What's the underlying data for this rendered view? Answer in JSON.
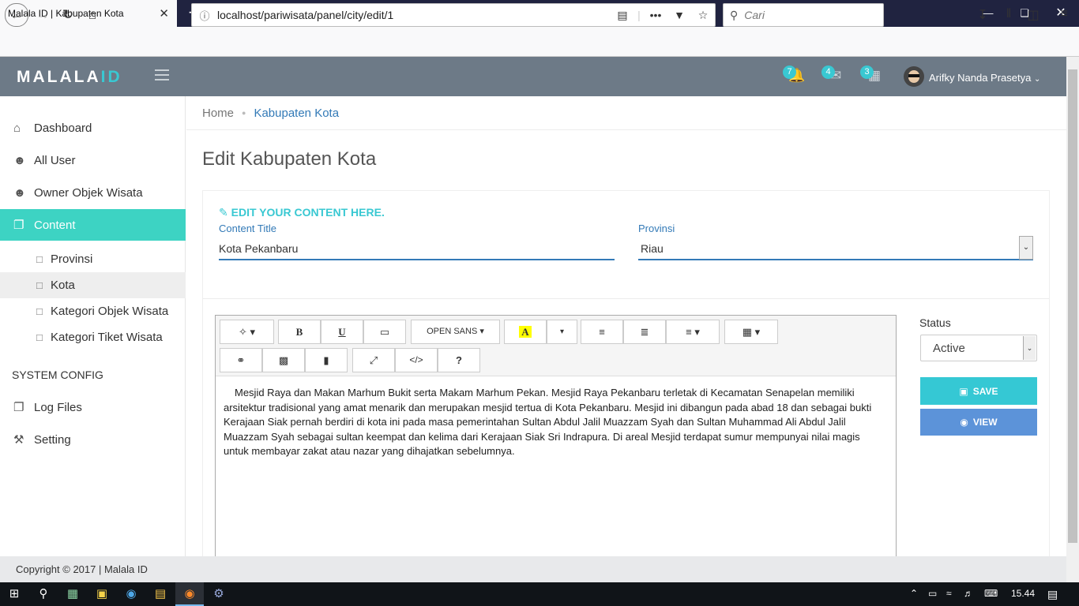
{
  "browser": {
    "tab_title": "Malala ID | Kabupaten Kota",
    "tab_close": "✕",
    "new_tab": "+",
    "url": "localhost/pariwisata/panel/city/edit/1",
    "search_placeholder": "Cari"
  },
  "header": {
    "logo_main": "MALALA",
    "logo_accent": "ID",
    "notifications_count": "7",
    "messages_count": "4",
    "calendar_count": "3",
    "user_name": "Arifky Nanda Prasetya"
  },
  "sidebar": {
    "items": [
      {
        "label": "Dashboard",
        "icon": "home-icon"
      },
      {
        "label": "All User",
        "icon": "user-icon"
      },
      {
        "label": "Owner Objek Wisata",
        "icon": "user-icon"
      },
      {
        "label": "Content",
        "icon": "copy-icon"
      }
    ],
    "sub_items": [
      "Provinsi",
      "Kota",
      "Kategori Objek Wisata",
      "Kategori Tiket Wisata"
    ],
    "section_label": "SYSTEM CONFIG",
    "config_items": [
      "Log Files",
      "Setting"
    ]
  },
  "breadcrumb": {
    "home": "Home",
    "current": "Kabupaten Kota"
  },
  "page_title": "Edit Kabupaten Kota",
  "form": {
    "header": "EDIT YOUR CONTENT HERE.",
    "title_label": "Content Title",
    "title_value": "Kota Pekanbaru",
    "province_label": "Provinsi",
    "province_value": "Riau",
    "font_label": "OPEN SANS",
    "content": "Mesjid Raya dan Makan Marhum Bukit serta Makam Marhum Pekan. Mesjid Raya Pekanbaru terletak di Kecamatan Senapelan memiliki arsitektur tradisional yang amat menarik dan merupakan mesjid tertua di Kota Pekanbaru. Mesjid ini dibangun pada abad 18 dan sebagai bukti Kerajaan Siak pernah berdiri di kota ini pada masa pemerintahan Sultan Abdul Jalil Muazzam Syah dan Sultan Muhammad Ali Abdul Jalil Muazzam Syah sebagai sultan keempat dan kelima dari Kerajaan Siak Sri Indrapura. Di areal Mesjid terdapat sumur mempunyai nilai magis untuk membayar zakat atau nazar yang dihajatkan sebelumnya.",
    "status_label": "Status",
    "status_value": "Active",
    "save_label": "SAVE",
    "view_label": "VIEW"
  },
  "footer": {
    "text": "Copyright © 2017 | Malala ID"
  },
  "taskbar": {
    "clock": "15.44"
  },
  "colors": {
    "accent": "#39c8d2",
    "active_menu": "#3dd3c3",
    "header": "#6d7a87",
    "view_button": "#5c93d9"
  }
}
